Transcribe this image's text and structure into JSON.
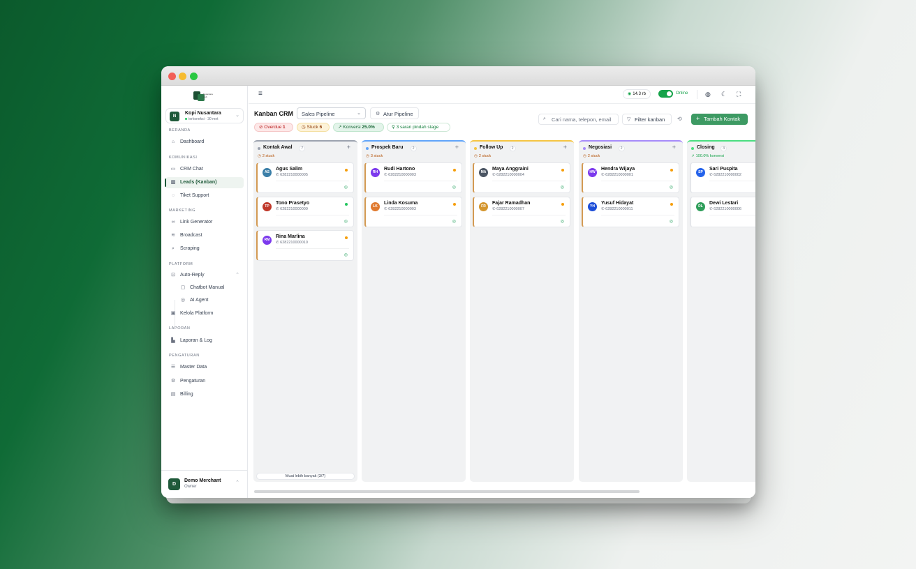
{
  "app": {
    "logo_text": "Nusantara Hub"
  },
  "workspace": {
    "avatar": "N",
    "name": "Kopi Nusantara",
    "status": "terkoneksi · 30 mnt"
  },
  "sidebar": {
    "sections": [
      {
        "title": "BERANDA"
      },
      {
        "title": "KOMUNIKASI"
      },
      {
        "title": "MARKETING"
      },
      {
        "title": "PLATFORM"
      },
      {
        "title": "LAPORAN"
      },
      {
        "title": "PENGATURAN"
      }
    ],
    "items": [
      {
        "label": "Dashboard",
        "icon": "home-icon"
      },
      {
        "label": "CRM Chat",
        "icon": "chat-icon"
      },
      {
        "label": "Leads (Kanban)",
        "icon": "kanban-icon"
      },
      {
        "label": "Tiket Support",
        "icon": "headset-icon"
      },
      {
        "label": "Link Generator",
        "icon": "link-icon"
      },
      {
        "label": "Broadcast",
        "icon": "broadcast-icon"
      },
      {
        "label": "Scraping",
        "icon": "search-icon"
      },
      {
        "label": "Auto-Reply",
        "icon": "bot-icon"
      },
      {
        "label": "Chatbot Manual",
        "icon": "message-square-icon"
      },
      {
        "label": "AI Agent",
        "icon": "sparkle-icon"
      },
      {
        "label": "Kelola Platform",
        "icon": "platform-icon"
      },
      {
        "label": "Laporan & Log",
        "icon": "bar-chart-icon"
      },
      {
        "label": "Master Data",
        "icon": "database-icon"
      },
      {
        "label": "Pengaturan",
        "icon": "gear-icon"
      },
      {
        "label": "Billing",
        "icon": "billing-icon"
      }
    ]
  },
  "user": {
    "avatar": "D",
    "name": "Demo Merchant",
    "role": "Owner"
  },
  "topbar": {
    "credit": "14.3 rb",
    "status": "Online"
  },
  "header": {
    "title": "Kanban CRM",
    "pipeline_selected": "Sales Pipeline",
    "manage_pipeline": "Atur Pipeline",
    "search_placeholder": "Cari nama, telepon, email",
    "filter_label": "Filter kanban",
    "add_contact": "Tambah Kontak"
  },
  "chips": {
    "overdue_label": "Overdue",
    "overdue_count": "1",
    "stuck_label": "Stuck",
    "stuck_count": "6",
    "conversion_label": "Konversi",
    "conversion_value": "25.0%",
    "suggestion": "3 saran pindah stage"
  },
  "columns": [
    {
      "title": "Kontak Awal",
      "count": "7",
      "stat": "2 stuck",
      "color": "#9ca3af",
      "more": "Muat lebih banyak (3/7)",
      "cards": [
        {
          "initials": "AS",
          "name": "Agus Salim",
          "phone": "6282210000005",
          "priority": "#f59e0b",
          "av_color": "#3b7fa8"
        },
        {
          "initials": "TP",
          "name": "Tono Prasetyo",
          "phone": "6282210000009",
          "priority": "#22c55e",
          "av_color": "#c0392b"
        },
        {
          "initials": "RM",
          "name": "Rina Marlina",
          "phone": "6282210000010",
          "priority": "#f59e0b",
          "av_color": "#7c3aed"
        }
      ]
    },
    {
      "title": "Prospek Baru",
      "count": "2",
      "stat": "3 stuck",
      "color": "#60a5fa",
      "cards": [
        {
          "initials": "RH",
          "name": "Rudi Hartono",
          "phone": "6282210000003",
          "priority": "#f59e0b",
          "av_color": "#7c3aed"
        },
        {
          "initials": "LK",
          "name": "Linda Kosuma",
          "phone": "6282210000003",
          "priority": "#f59e0b",
          "av_color": "#e07a2f"
        }
      ]
    },
    {
      "title": "Follow Up",
      "count": "2",
      "stat": "2 stuck",
      "color": "#f5c542",
      "cards": [
        {
          "initials": "MA",
          "name": "Maya Anggraini",
          "phone": "6282210000004",
          "priority": "#f59e0b",
          "av_color": "#4b5563"
        },
        {
          "initials": "FR",
          "name": "Fajar Ramadhan",
          "phone": "6282210000007",
          "priority": "#f59e0b",
          "av_color": "#d4962e"
        }
      ]
    },
    {
      "title": "Negosiasi",
      "count": "2",
      "stat": "2 stuck",
      "color": "#a78bfa",
      "cards": [
        {
          "initials": "HW",
          "name": "Hendra Wijaya",
          "phone": "6282210000001",
          "priority": "#f59e0b",
          "av_color": "#7c3aed"
        },
        {
          "initials": "YH",
          "name": "Yusuf Hidayat",
          "phone": "6282210000011",
          "priority": "#f59e0b",
          "av_color": "#1d4ed8"
        }
      ]
    },
    {
      "title": "Closing",
      "count": "3",
      "stat": "100.0% konversi",
      "color": "#4ade80",
      "cards": [
        {
          "initials": "SP",
          "name": "Sari Puspita",
          "phone": "6282210000002",
          "priority": "",
          "av_color": "#2563eb"
        },
        {
          "initials": "DL",
          "name": "Dewi Lestari",
          "phone": "6282210000006",
          "priority": "",
          "av_color": "#2f9e5a"
        }
      ]
    }
  ]
}
